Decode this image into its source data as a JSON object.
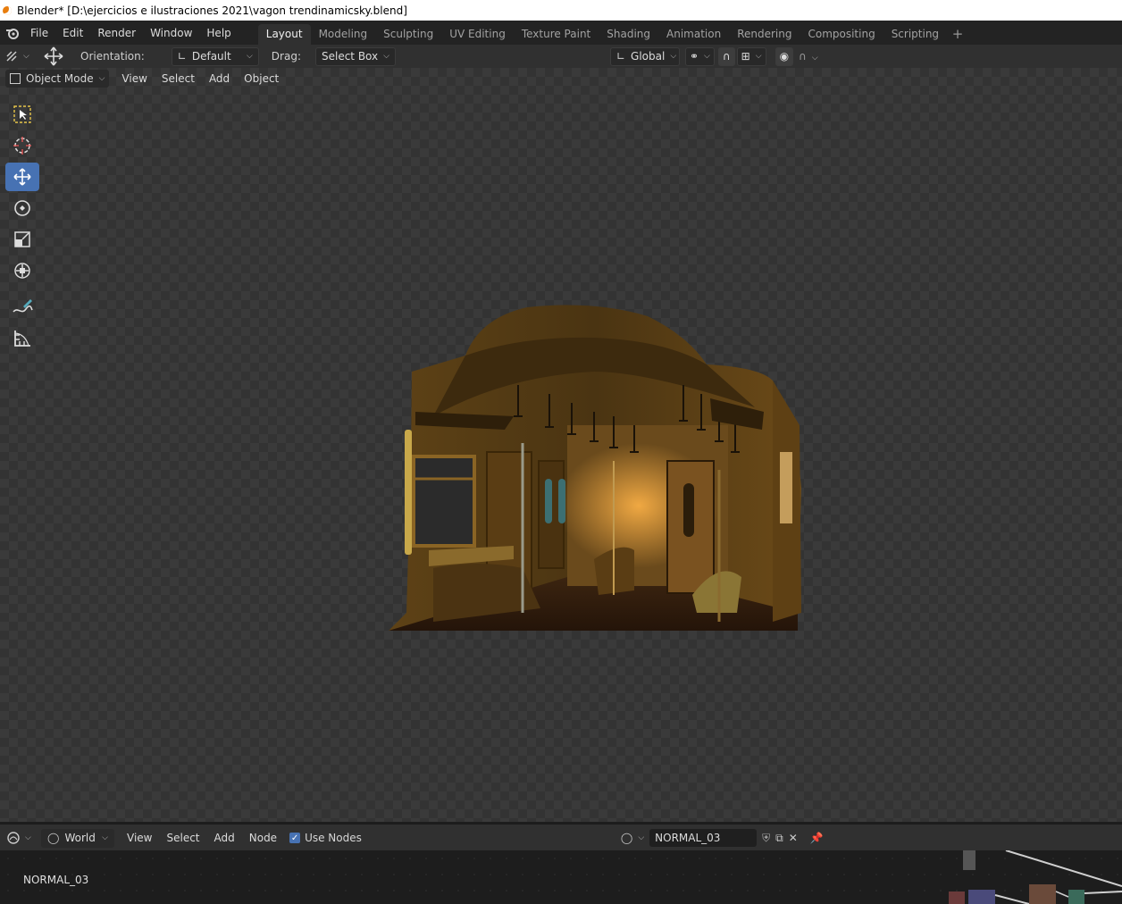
{
  "window": {
    "title": "Blender* [D:\\ejercicios e ilustraciones 2021\\vagon trendinamicsky.blend]"
  },
  "menu": {
    "items": [
      "File",
      "Edit",
      "Render",
      "Window",
      "Help"
    ]
  },
  "workspaces": {
    "tabs": [
      "Layout",
      "Modeling",
      "Sculpting",
      "UV Editing",
      "Texture Paint",
      "Shading",
      "Animation",
      "Rendering",
      "Compositing",
      "Scripting"
    ],
    "active": "Layout"
  },
  "tool_header": {
    "orientation_label": "Orientation:",
    "orientation_value": "Default",
    "drag_label": "Drag:",
    "drag_value": "Select Box",
    "transform_orientation": "Global"
  },
  "viewport_header": {
    "mode": "Object Mode",
    "menus": [
      "View",
      "Select",
      "Add",
      "Object"
    ]
  },
  "toolbar": {
    "tools": [
      "select-box",
      "cursor",
      "move",
      "rotate",
      "scale",
      "transform",
      "annotate",
      "measure"
    ],
    "active": "move"
  },
  "node_header": {
    "world_type": "World",
    "menus": [
      "View",
      "Select",
      "Add",
      "Node"
    ],
    "use_nodes_label": "Use Nodes",
    "use_nodes": true,
    "world_name": "NORMAL_03"
  },
  "node_editor": {
    "label": "NORMAL_03"
  },
  "colors": {
    "accent": "#4772b3",
    "background": "#1d1d1d",
    "header": "#303030"
  }
}
